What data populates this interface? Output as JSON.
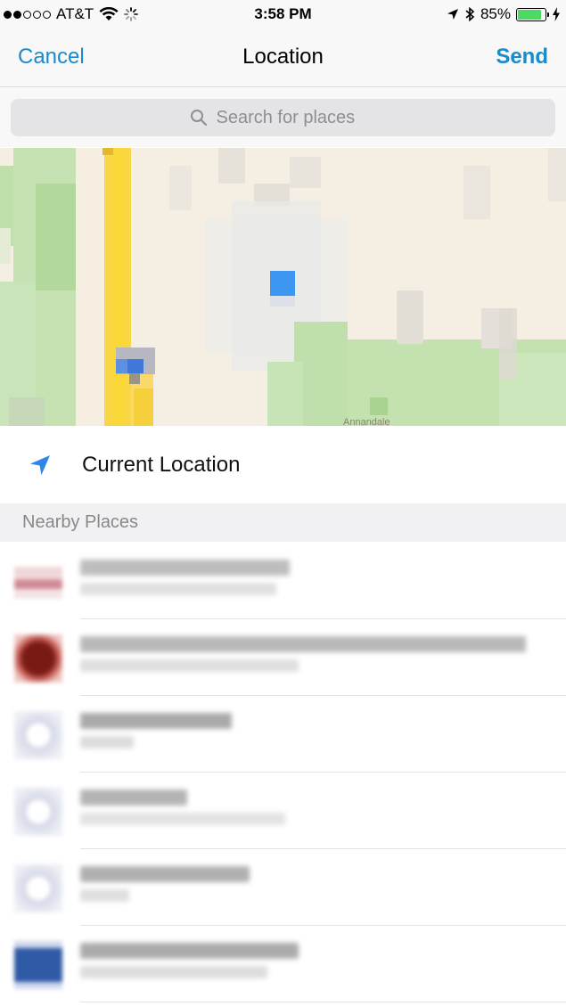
{
  "status_bar": {
    "carrier": "AT&T",
    "time": "3:58 PM",
    "battery_percent": "85%",
    "battery_level": 0.85,
    "signal_bars": 2,
    "icons": [
      "wifi-icon",
      "activity-spinner-icon",
      "location-arrow-icon",
      "bluetooth-icon",
      "charging-bolt-icon"
    ]
  },
  "nav": {
    "cancel_label": "Cancel",
    "title": "Location",
    "send_label": "Send"
  },
  "search": {
    "placeholder": "Search for places"
  },
  "map": {
    "attribution": "Annandale"
  },
  "current_location": {
    "label": "Current Location"
  },
  "nearby": {
    "section_title": "Nearby Places"
  },
  "colors": {
    "accent": "#1a8ac8",
    "location_arrow": "#2f86e8",
    "battery": "#4cd964"
  }
}
